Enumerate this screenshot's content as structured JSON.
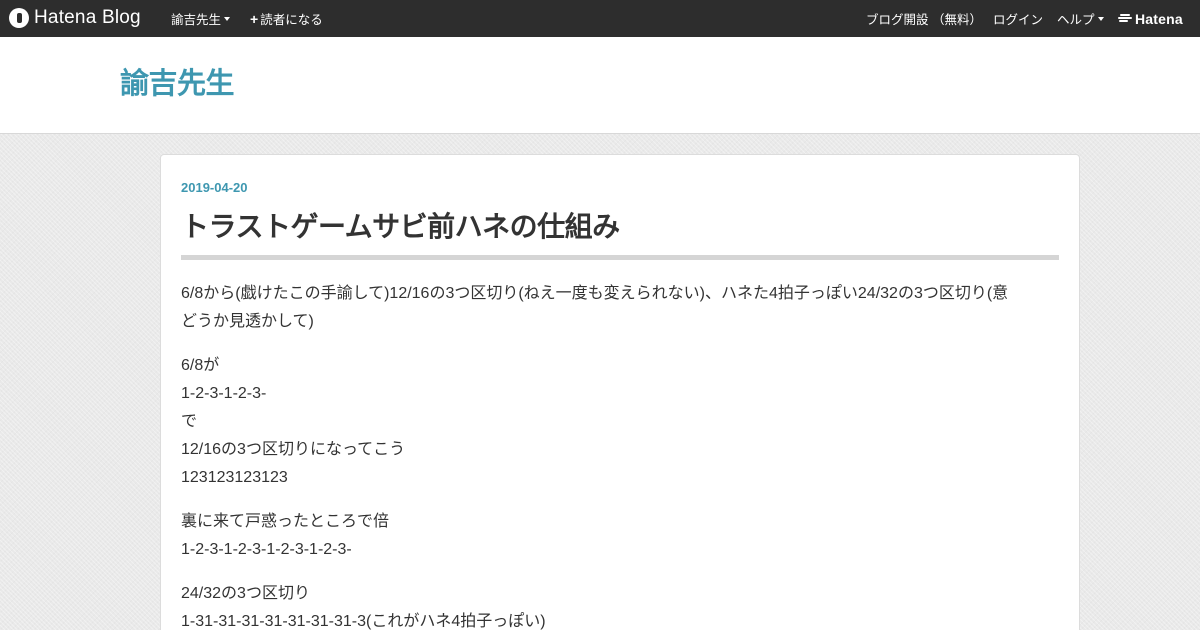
{
  "global_header": {
    "logo_text": "Hatena Blog",
    "blog_menu_label": "諭吉先生",
    "subscribe_label": "読者になる",
    "open_blog_label": "ブログ開設 （無料）",
    "login_label": "ログイン",
    "help_label": "ヘルプ",
    "brand_label": "Hatena"
  },
  "blog": {
    "title": "諭吉先生"
  },
  "entry": {
    "date": "2019-04-20",
    "title": "トラストゲームサビ前ハネの仕組み",
    "paragraphs": [
      {
        "lines": [
          "6/8から(戯けたこの手諭して)12/16の3つ区切り(ねえ一度も変えられない)、ハネた4拍子っぽい24/32の3つ区切り(意",
          "どうか見透かして)"
        ]
      },
      {
        "lines": [
          "6/8が",
          "1-2-3-1-2-3-",
          "で",
          "12/16の3つ区切りになってこう",
          "123123123123"
        ]
      },
      {
        "lines": [
          "裏に来て戸惑ったところで倍",
          "1-2-3-1-2-3-1-2-3-1-2-3-"
        ]
      },
      {
        "lines": [
          "24/32の3つ区切り",
          "1-31-31-31-31-31-31-31-3(これがハネ4拍子っぽい)"
        ]
      }
    ]
  },
  "colors": {
    "topbar": "#2d2d2d",
    "accent": "#3e97b0",
    "text": "#333333"
  }
}
